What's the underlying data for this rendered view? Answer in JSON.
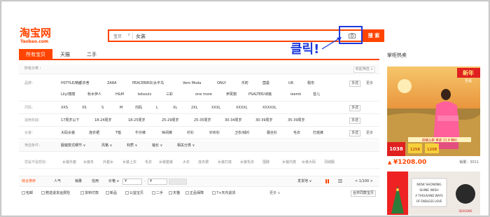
{
  "logo": {
    "cn": "淘宝网",
    "en": "Taobao.com"
  },
  "search": {
    "category": "宝贝",
    "query": "女装",
    "button": "搜 索"
  },
  "annotation": {
    "text": "클릭!"
  },
  "tabs": [
    "所有宝贝",
    "天猫",
    "二手"
  ],
  "side": {
    "title": "掌柜热卖",
    "ad1_banner": "新年",
    "ad1_sub": "圣诞",
    "ad1_red_price": "1038",
    "ad1_yellow_1": "1258",
    "ad1_yellow_2": "1208",
    "ad1_tag": "店铺上新 本店 11.9 特价",
    "price": "¥1208.00",
    "sales": "销量：3011",
    "ad2_lines": [
      "NOW SHOWING",
      "SHINE WISH",
      "A THOUSAND WAYS",
      "OF ENDLESS LOVE"
    ],
    "ad2_corner": "SEASONS"
  },
  "breadcrumb": {
    "left": "所有分类 ›",
    "right": "收起筛选 ∧"
  },
  "filters": {
    "brand": {
      "label": "品牌：",
      "row1": [
        "HSTYLE/韩都衣舍",
        "ZARA",
        "PEACEBIRD/太平鸟",
        "Vero Moda",
        "ONLY",
        "乐町",
        "茵曼",
        "UR",
        "裂帛",
        "Lily/丽丽",
        "秋水伊人",
        "H&M",
        "bdsoulz",
        "三彩",
        "one more",
        "伊芙丽",
        "PSALTER/诗篇",
        "ieemk",
        "音儿"
      ],
      "multi": "多选",
      "more": "更多"
    },
    "size": {
      "label": "尺码：",
      "items": [
        "XXS",
        "XS",
        "S",
        "M",
        "均码",
        "L",
        "XL",
        "2XL",
        "XXXL",
        "XXXXL",
        "XXXXXL"
      ],
      "multi": "多选"
    },
    "age": {
      "label": "适用年龄：",
      "items": [
        "17周岁以下",
        "18-24周岁",
        "18-25周岁",
        "25-29周岁",
        "25-35周岁",
        "30-34周岁",
        "30-39周岁",
        "35-39周岁"
      ],
      "multi": "多选"
    },
    "type": {
      "label": "女装：",
      "items": [
        "大码女装",
        "连衣裙",
        "T恤",
        "牛仔裤",
        "休闲裤",
        "衬衫",
        "针织衫",
        "卫衣/绒衫",
        "蕾丝衫",
        "毛衣",
        "打底裤"
      ],
      "multi": "多选",
      "more": "更多"
    },
    "options": {
      "label": "筛选条件：",
      "items": [
        "服装款式细节 ∨",
        "风格 ∨",
        "材质 ∨",
        "袖长 ∨",
        "相关分类 ∨"
      ]
    },
    "related": {
      "label": "您是不是想找：",
      "items": [
        "女装外套",
        "女装冬",
        "外套女",
        "女装上衣",
        "毛衣",
        "女装套装",
        "大衣",
        "连衣裙",
        "女装打底",
        "女装毛衣",
        "围脖",
        "女装内搭",
        "女装大码",
        "羽绒服"
      ]
    }
  },
  "sort": {
    "items": [
      "综合排序",
      "人气",
      "销量",
      "信用",
      "价格 ∨"
    ],
    "price_from": "¥",
    "price_to": "¥",
    "ship_from": "发货地 ∨",
    "page": "< 1/100 >"
  },
  "options_row": {
    "items": [
      "包邮",
      "赠送退货运费险",
      "货到付款",
      "新品",
      "公益宝贝",
      "二手",
      "天猫",
      "正品保障",
      "7+天内退货"
    ],
    "more": "更多 ∨",
    "merge": "合并同款宝贝"
  },
  "colors": {
    "accent": "#ff4400",
    "annotation": "#1e3adb"
  }
}
